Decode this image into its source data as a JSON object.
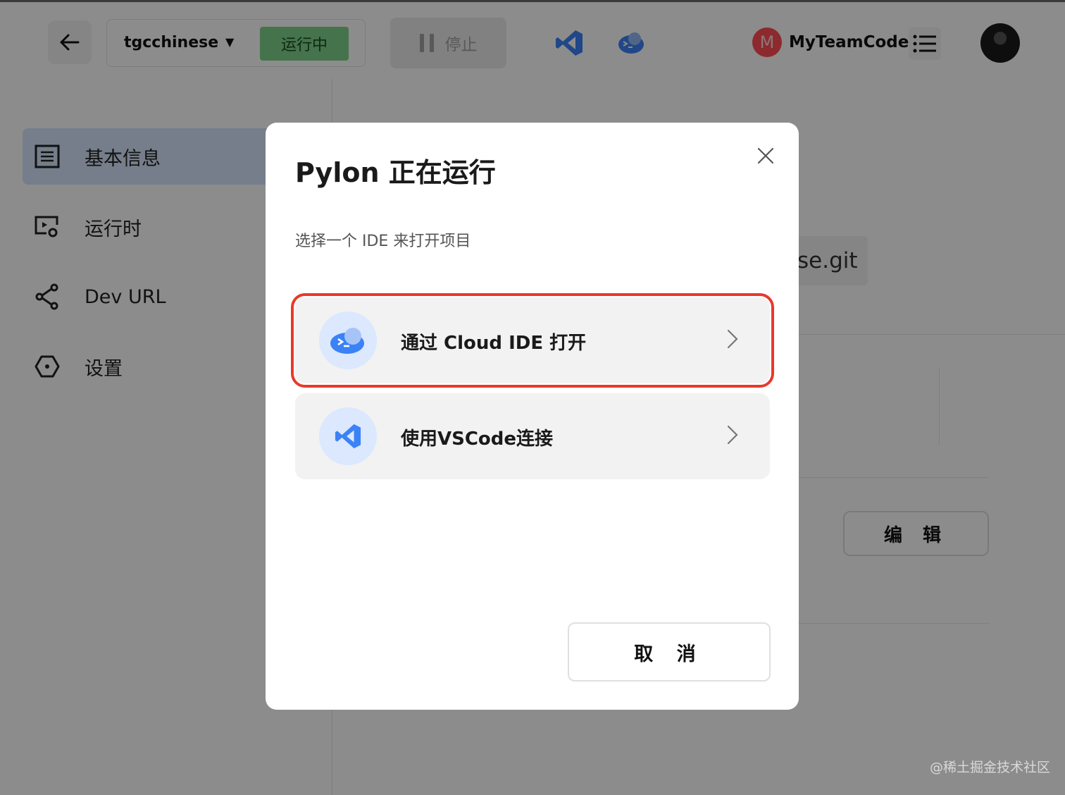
{
  "header": {
    "workspace_name": "tgcchinese",
    "workspace_status": "运行中",
    "stop_label": "停止",
    "team_initial": "M",
    "team_name": "MyTeamCode"
  },
  "sidebar": {
    "items": [
      {
        "label": "基本信息",
        "icon": "document-list-icon",
        "active": true
      },
      {
        "label": "运行时",
        "icon": "runtime-monitor-icon",
        "active": false
      },
      {
        "label": "Dev URL",
        "icon": "share-icon",
        "active": false
      },
      {
        "label": "设置",
        "icon": "settings-hexagon-icon",
        "active": false
      }
    ]
  },
  "main": {
    "repo_fragment": "se.git",
    "edit_label": "编 辑"
  },
  "modal": {
    "title": "Pylon 正在运行",
    "subtitle": "选择一个 IDE 来打开项目",
    "options": [
      {
        "label": "通过 Cloud IDE 打开",
        "icon": "cloud-terminal-icon",
        "highlighted": true
      },
      {
        "label": "使用VSCode连接",
        "icon": "vscode-icon",
        "highlighted": false
      }
    ],
    "cancel_label": "取 消"
  },
  "watermark": "@稀土掘金技术社区",
  "colors": {
    "running_green": "#7fd18a",
    "active_blue": "#d6e5fb",
    "highlight_red": "#e8392b",
    "icon_blue": "#3b82f6"
  }
}
